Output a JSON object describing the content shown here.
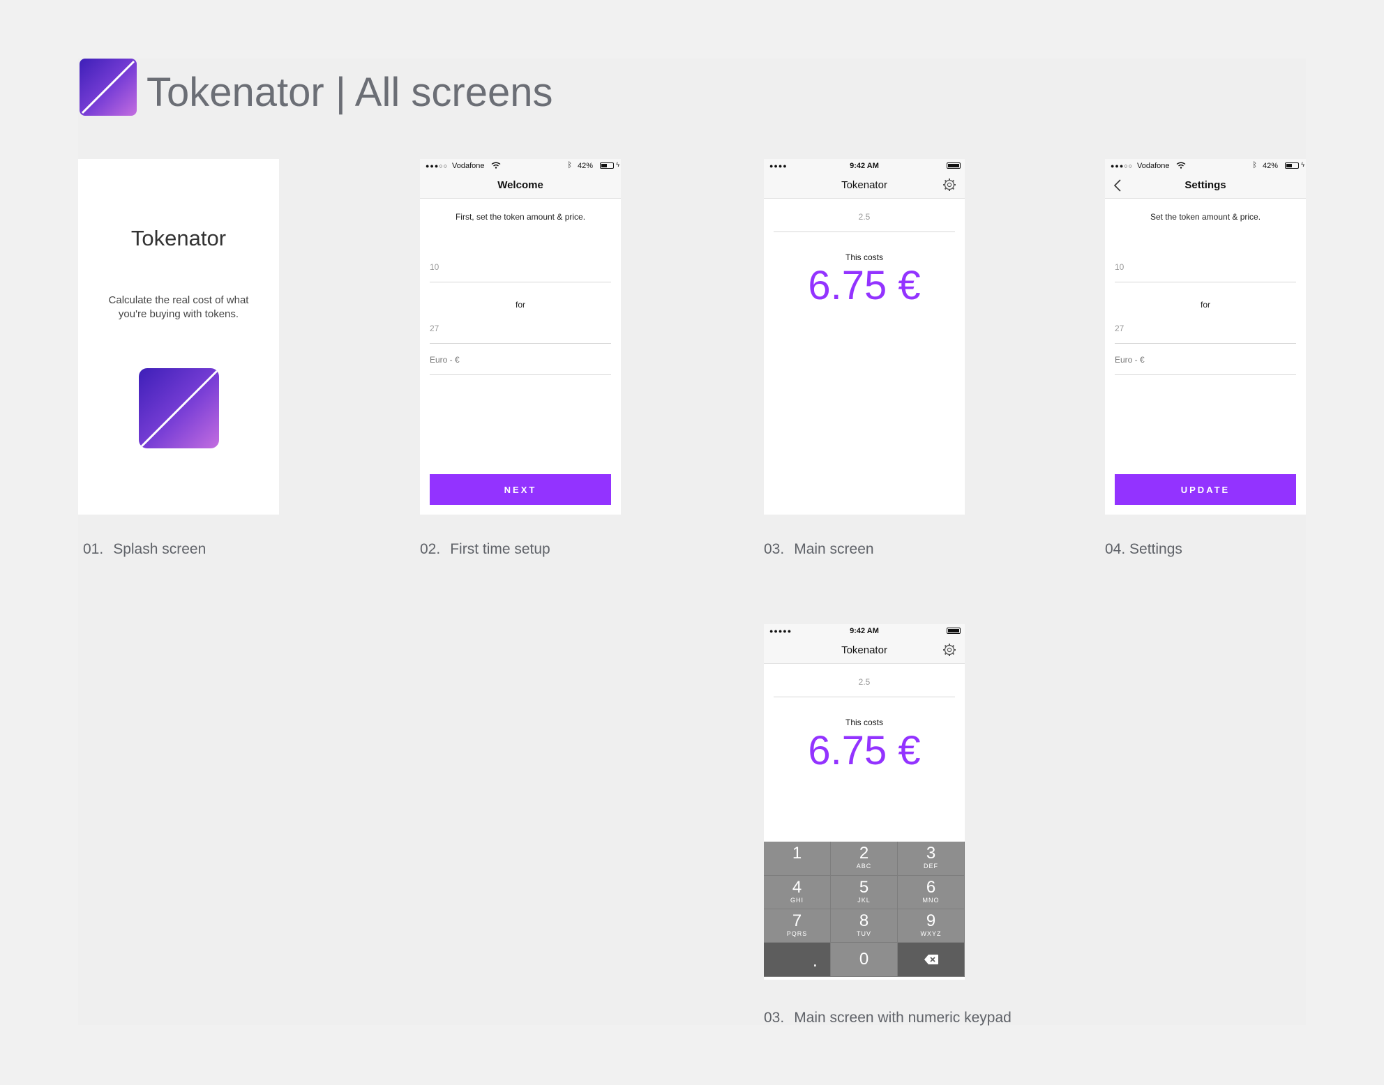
{
  "header": {
    "title": "Tokenator | All screens"
  },
  "colors": {
    "accent": "#9333ff",
    "gradient_start": "#3d1fb8",
    "gradient_end": "#c46ee0"
  },
  "splash": {
    "app_name": "Tokenator",
    "tagline_line1": "Calculate the real cost of what",
    "tagline_line2": "you're buying with tokens.",
    "caption_num": "01.",
    "caption_label": "Splash screen"
  },
  "setup": {
    "status": {
      "dots": "●●●○○",
      "carrier": "Vodafone",
      "battery": "42%"
    },
    "nav_title": "Welcome",
    "instruction": "First, set the token amount & price.",
    "token_amount": "10",
    "for_label": "for",
    "price": "27",
    "currency": "Euro - €",
    "button": "NEXT",
    "caption_num": "02.",
    "caption_label": "First time setup"
  },
  "main": {
    "status": {
      "dots": "●●●●",
      "time": "9:42 AM"
    },
    "nav_title": "Tokenator",
    "input_value": "2.5",
    "cost_label": "This costs",
    "cost_value": "6.75 €",
    "caption_num": "03.",
    "caption_label": "Main screen"
  },
  "settings": {
    "status": {
      "dots": "●●●○○",
      "carrier": "Vodafone",
      "battery": "42%"
    },
    "nav_title": "Settings",
    "instruction": "Set the token amount & price.",
    "token_amount": "10",
    "for_label": "for",
    "price": "27",
    "currency": "Euro - €",
    "button": "UPDATE",
    "caption": "04. Settings"
  },
  "keypad_screen": {
    "status": {
      "dots": "●●●●●",
      "time": "9:42 AM"
    },
    "nav_title": "Tokenator",
    "input_value": "2.5",
    "cost_label": "This costs",
    "cost_value": "6.75 €",
    "keys": [
      {
        "digit": "1",
        "letters": ""
      },
      {
        "digit": "2",
        "letters": "ABC"
      },
      {
        "digit": "3",
        "letters": "DEF"
      },
      {
        "digit": "4",
        "letters": "GHI"
      },
      {
        "digit": "5",
        "letters": "JKL"
      },
      {
        "digit": "6",
        "letters": "MNO"
      },
      {
        "digit": "7",
        "letters": "PQRS"
      },
      {
        "digit": "8",
        "letters": "TUV"
      },
      {
        "digit": "9",
        "letters": "WXYZ"
      }
    ],
    "key_decimal": ".",
    "key_zero": "0",
    "caption_num": "03.",
    "caption_label": "Main screen with numeric keypad"
  }
}
